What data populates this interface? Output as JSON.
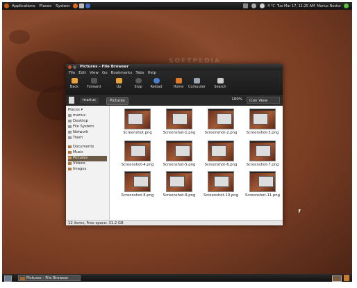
{
  "top_panel": {
    "menus": [
      "Applications",
      "Places",
      "System"
    ],
    "temperature": "4 °C",
    "datetime": "Tue Mar 17, 11:25 AM",
    "user": "Marius Nestor"
  },
  "watermark": "SOFTPEDIA",
  "window": {
    "title": "Pictures - File Browser",
    "menu": [
      "File",
      "Edit",
      "View",
      "Go",
      "Bookmarks",
      "Tabs",
      "Help"
    ],
    "toolbar": {
      "back": "Back",
      "forward": "Forward",
      "up": "Up",
      "stop": "Stop",
      "reload": "Reload",
      "home": "Home",
      "computer": "Computer",
      "search": "Search"
    },
    "location": {
      "crumbs": [
        "marius",
        "Pictures"
      ],
      "zoom": "100%",
      "view_mode": "Icon View"
    },
    "sidebar": {
      "header": "Places",
      "items": [
        "marius",
        "Desktop",
        "File System",
        "Network",
        "Trash",
        "Documents",
        "Music",
        "Pictures",
        "Videos",
        "Images"
      ],
      "active": "Pictures"
    },
    "files": [
      "Screenshot.png",
      "Screenshot-1.png",
      "Screenshot-2.png",
      "Screenshot-3.png",
      "Screenshot-4.png",
      "Screenshot-5.png",
      "Screenshot-6.png",
      "Screenshot-7.png",
      "Screenshot-8.png",
      "Screenshot-9.png",
      "Screenshot-10.png",
      "Screenshot-11.png"
    ],
    "status": "12 items, Free space: 31.2 GB"
  },
  "bottom_panel": {
    "task": "Pictures - File Browser"
  }
}
